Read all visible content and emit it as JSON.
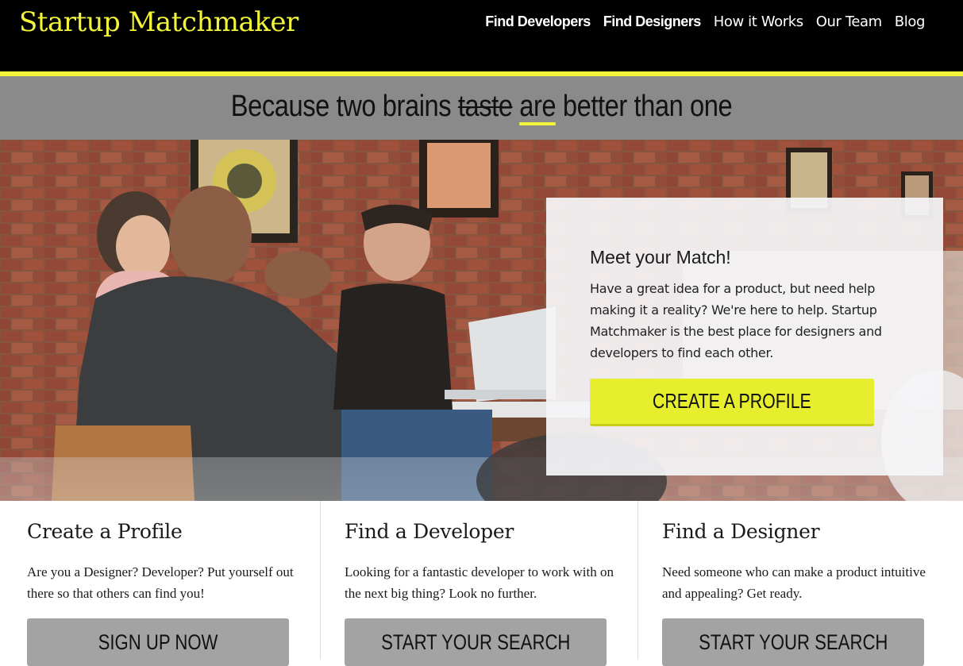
{
  "header": {
    "brand": "Startup Matchmaker",
    "brand_color": "#f3f53a",
    "nav": [
      {
        "label": "Find Developers"
      },
      {
        "label": "Find Designers"
      },
      {
        "label": "How it Works"
      },
      {
        "label": "Our Team"
      },
      {
        "label": "Blog"
      }
    ]
  },
  "tagline": {
    "before": "Because two brains",
    "struck": "taste",
    "underlined": "are",
    "after": "better than one"
  },
  "hero": {
    "image": "photo-cafe-people-working",
    "card": {
      "title": "Meet your Match!",
      "body": "Have a great idea for a product, but need help making it a reality? We're here to help. Startup Matchmaker is the best place for designers and developers to find each other.",
      "cta": "CREATE A PROFILE"
    }
  },
  "features": [
    {
      "title": "Create a Profile",
      "text": "Are you a Designer? Developer? Put yourself out there so that others can find you!",
      "button": "SIGN UP NOW"
    },
    {
      "title": "Find a Developer",
      "text": "Looking for a fantastic developer to work with on the next big thing? Look no further.",
      "button": "START YOUR SEARCH"
    },
    {
      "title": "Find a Designer",
      "text": "Need someone who can make a product intuitive and appealing? Get ready.",
      "button": "START YOUR SEARCH"
    }
  ],
  "colors": {
    "accent": "#f3f53a",
    "header_bg": "#000000",
    "band_bg": "#8a8a8a",
    "button_grey": "#a3a3a3"
  }
}
